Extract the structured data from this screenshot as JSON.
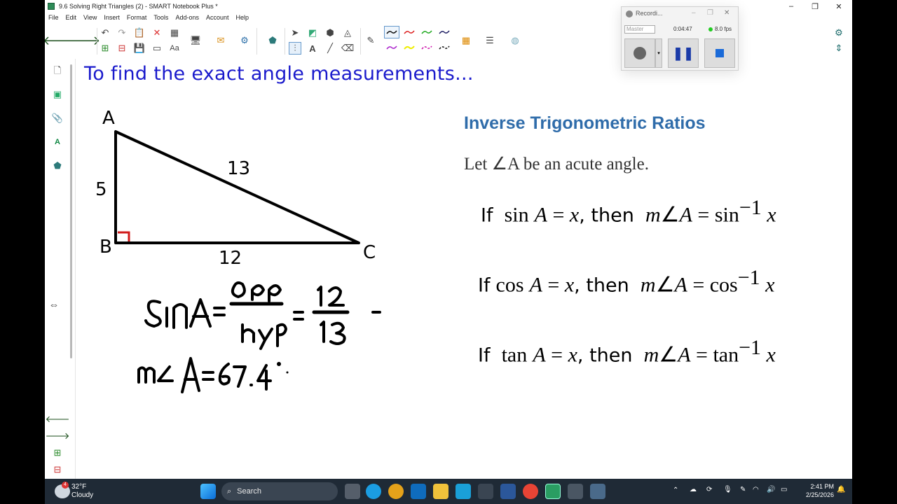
{
  "window": {
    "title": "9.6 Solving Right Triangles (2) - SMART Notebook Plus *",
    "controls": [
      "–",
      "❐",
      "✕"
    ]
  },
  "menu": [
    "File",
    "Edit",
    "View",
    "Insert",
    "Format",
    "Tools",
    "Add-ons",
    "Account",
    "Help"
  ],
  "recorder": {
    "title": "Recordi...",
    "source": "Master",
    "time": "0:04:47",
    "fps": "8.0 fps"
  },
  "slide": {
    "heading": "To find the exact angle measurements...",
    "triangle": {
      "vertices": [
        "A",
        "B",
        "C"
      ],
      "side_ab": "5",
      "side_ac": "13",
      "side_bc": "12"
    },
    "handwriting": {
      "line1": "sinA = opp/hyp = 12/13",
      "line2": "m∠A = 67.4°"
    },
    "inverse_box": {
      "title": "Inverse Trigonometric Ratios",
      "intro": "Let ∠A be an acute angle.",
      "rules": [
        {
          "if": "If",
          "fn": "sin",
          "then": "then",
          "inv": "sin"
        },
        {
          "if": "If",
          "fn": "cos",
          "then": "then",
          "inv": "cos"
        },
        {
          "if": "If",
          "fn": "tan",
          "then": "then",
          "inv": "tan"
        }
      ]
    }
  },
  "taskbar": {
    "weather_temp": "32°F",
    "weather_desc": "Cloudy",
    "weather_badge": "4",
    "search_placeholder": "Search",
    "time": "2:41 PM",
    "date": "2/25/2026"
  },
  "colors": {
    "heading": "#1a1acc",
    "inv_title": "#2f6caa",
    "right_angle_mark": "#d11a1a",
    "taskbar": "#1f2a36"
  }
}
